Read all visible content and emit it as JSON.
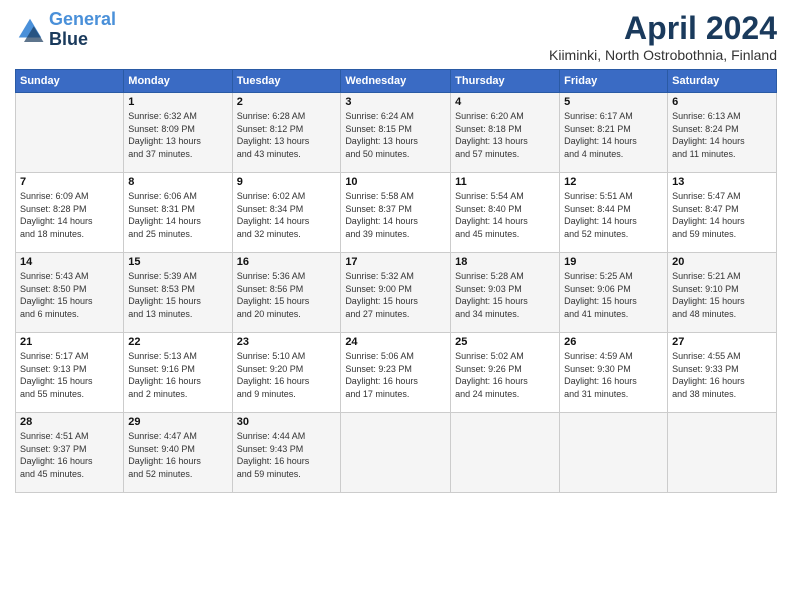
{
  "logo": {
    "line1": "General",
    "line2": "Blue"
  },
  "title": "April 2024",
  "location": "Kiiminki, North Ostrobothnia, Finland",
  "days_header": [
    "Sunday",
    "Monday",
    "Tuesday",
    "Wednesday",
    "Thursday",
    "Friday",
    "Saturday"
  ],
  "weeks": [
    [
      {
        "day": "",
        "info": ""
      },
      {
        "day": "1",
        "info": "Sunrise: 6:32 AM\nSunset: 8:09 PM\nDaylight: 13 hours\nand 37 minutes."
      },
      {
        "day": "2",
        "info": "Sunrise: 6:28 AM\nSunset: 8:12 PM\nDaylight: 13 hours\nand 43 minutes."
      },
      {
        "day": "3",
        "info": "Sunrise: 6:24 AM\nSunset: 8:15 PM\nDaylight: 13 hours\nand 50 minutes."
      },
      {
        "day": "4",
        "info": "Sunrise: 6:20 AM\nSunset: 8:18 PM\nDaylight: 13 hours\nand 57 minutes."
      },
      {
        "day": "5",
        "info": "Sunrise: 6:17 AM\nSunset: 8:21 PM\nDaylight: 14 hours\nand 4 minutes."
      },
      {
        "day": "6",
        "info": "Sunrise: 6:13 AM\nSunset: 8:24 PM\nDaylight: 14 hours\nand 11 minutes."
      }
    ],
    [
      {
        "day": "7",
        "info": "Sunrise: 6:09 AM\nSunset: 8:28 PM\nDaylight: 14 hours\nand 18 minutes."
      },
      {
        "day": "8",
        "info": "Sunrise: 6:06 AM\nSunset: 8:31 PM\nDaylight: 14 hours\nand 25 minutes."
      },
      {
        "day": "9",
        "info": "Sunrise: 6:02 AM\nSunset: 8:34 PM\nDaylight: 14 hours\nand 32 minutes."
      },
      {
        "day": "10",
        "info": "Sunrise: 5:58 AM\nSunset: 8:37 PM\nDaylight: 14 hours\nand 39 minutes."
      },
      {
        "day": "11",
        "info": "Sunrise: 5:54 AM\nSunset: 8:40 PM\nDaylight: 14 hours\nand 45 minutes."
      },
      {
        "day": "12",
        "info": "Sunrise: 5:51 AM\nSunset: 8:44 PM\nDaylight: 14 hours\nand 52 minutes."
      },
      {
        "day": "13",
        "info": "Sunrise: 5:47 AM\nSunset: 8:47 PM\nDaylight: 14 hours\nand 59 minutes."
      }
    ],
    [
      {
        "day": "14",
        "info": "Sunrise: 5:43 AM\nSunset: 8:50 PM\nDaylight: 15 hours\nand 6 minutes."
      },
      {
        "day": "15",
        "info": "Sunrise: 5:39 AM\nSunset: 8:53 PM\nDaylight: 15 hours\nand 13 minutes."
      },
      {
        "day": "16",
        "info": "Sunrise: 5:36 AM\nSunset: 8:56 PM\nDaylight: 15 hours\nand 20 minutes."
      },
      {
        "day": "17",
        "info": "Sunrise: 5:32 AM\nSunset: 9:00 PM\nDaylight: 15 hours\nand 27 minutes."
      },
      {
        "day": "18",
        "info": "Sunrise: 5:28 AM\nSunset: 9:03 PM\nDaylight: 15 hours\nand 34 minutes."
      },
      {
        "day": "19",
        "info": "Sunrise: 5:25 AM\nSunset: 9:06 PM\nDaylight: 15 hours\nand 41 minutes."
      },
      {
        "day": "20",
        "info": "Sunrise: 5:21 AM\nSunset: 9:10 PM\nDaylight: 15 hours\nand 48 minutes."
      }
    ],
    [
      {
        "day": "21",
        "info": "Sunrise: 5:17 AM\nSunset: 9:13 PM\nDaylight: 15 hours\nand 55 minutes."
      },
      {
        "day": "22",
        "info": "Sunrise: 5:13 AM\nSunset: 9:16 PM\nDaylight: 16 hours\nand 2 minutes."
      },
      {
        "day": "23",
        "info": "Sunrise: 5:10 AM\nSunset: 9:20 PM\nDaylight: 16 hours\nand 9 minutes."
      },
      {
        "day": "24",
        "info": "Sunrise: 5:06 AM\nSunset: 9:23 PM\nDaylight: 16 hours\nand 17 minutes."
      },
      {
        "day": "25",
        "info": "Sunrise: 5:02 AM\nSunset: 9:26 PM\nDaylight: 16 hours\nand 24 minutes."
      },
      {
        "day": "26",
        "info": "Sunrise: 4:59 AM\nSunset: 9:30 PM\nDaylight: 16 hours\nand 31 minutes."
      },
      {
        "day": "27",
        "info": "Sunrise: 4:55 AM\nSunset: 9:33 PM\nDaylight: 16 hours\nand 38 minutes."
      }
    ],
    [
      {
        "day": "28",
        "info": "Sunrise: 4:51 AM\nSunset: 9:37 PM\nDaylight: 16 hours\nand 45 minutes."
      },
      {
        "day": "29",
        "info": "Sunrise: 4:47 AM\nSunset: 9:40 PM\nDaylight: 16 hours\nand 52 minutes."
      },
      {
        "day": "30",
        "info": "Sunrise: 4:44 AM\nSunset: 9:43 PM\nDaylight: 16 hours\nand 59 minutes."
      },
      {
        "day": "",
        "info": ""
      },
      {
        "day": "",
        "info": ""
      },
      {
        "day": "",
        "info": ""
      },
      {
        "day": "",
        "info": ""
      }
    ]
  ]
}
